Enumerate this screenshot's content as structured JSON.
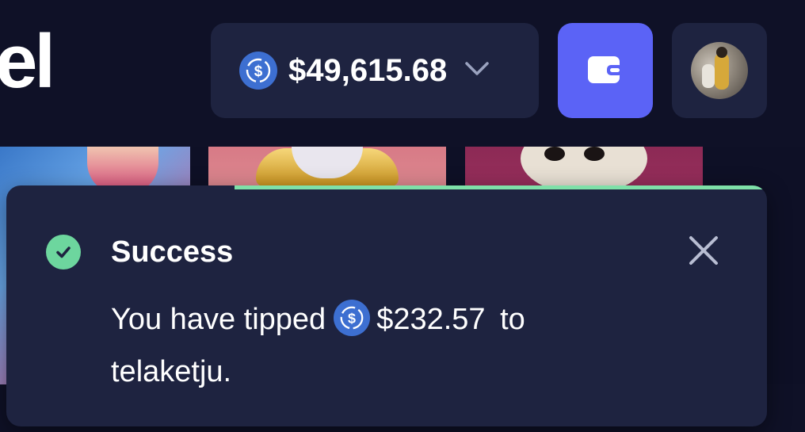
{
  "header": {
    "logo_fragment": "el",
    "balance": {
      "currency_icon": "usdc-coin-icon",
      "amount": "$49,615.68",
      "dropdown_icon": "chevron-down-icon"
    },
    "wallet_button_icon": "wallet-icon",
    "avatar_alt": "user-avatar"
  },
  "toast": {
    "status": "success",
    "title": "Success",
    "message_prefix": "You have tipped",
    "coin_icon": "usdc-coin-icon",
    "amount": "$232.57",
    "message_to": "to",
    "recipient": "telaketju.",
    "progress_remaining": 0.7,
    "colors": {
      "success": "#6dd69e",
      "progress": "#7ee0a8",
      "background": "#1e2340"
    }
  },
  "colors": {
    "page_bg": "#0e1026",
    "pill_bg": "#1e2340",
    "accent": "#5b63f6",
    "coin": "#3d6fd1"
  }
}
